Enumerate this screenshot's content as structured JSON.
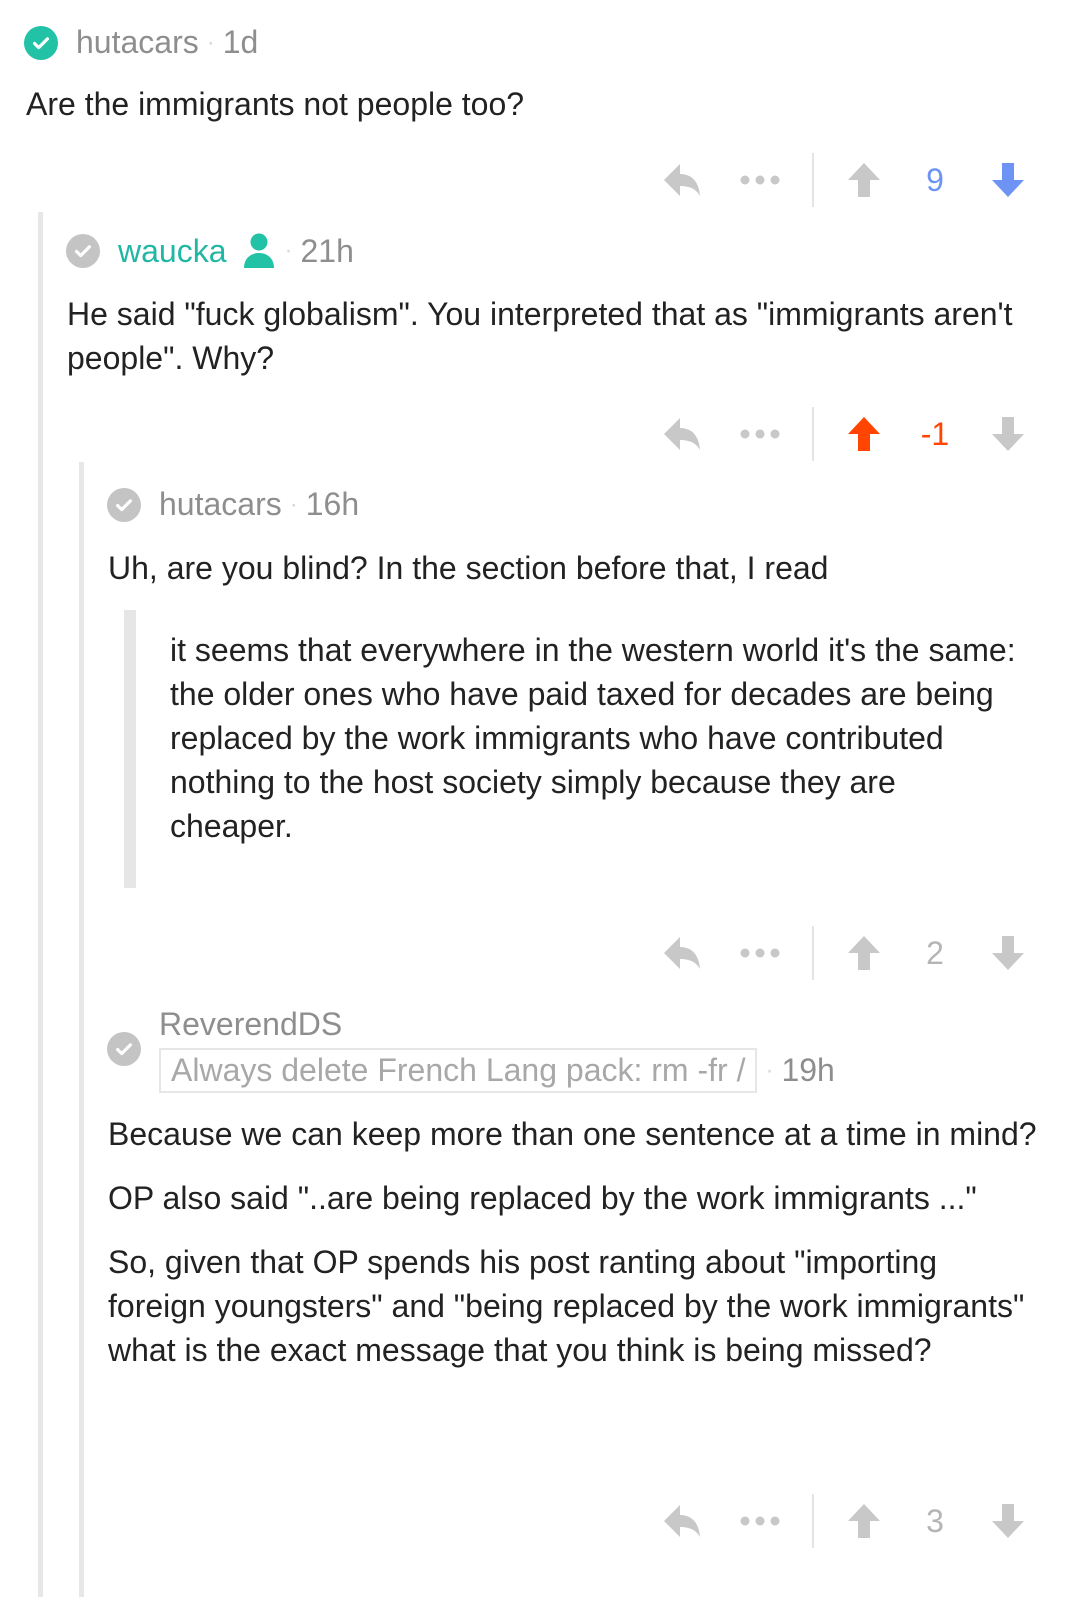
{
  "colors": {
    "teal": "#21b7a4",
    "upvote_orange": "#ff4500",
    "downvote_blue": "#6d94f5",
    "grey_icon": "#c8c8c8",
    "score_blue": "#6d94f5",
    "score_orange": "#ff4500",
    "score_grey": "#b5b5b5"
  },
  "comments": [
    {
      "author": "hutacars",
      "time": "1d",
      "badge_icon": "check-circle-green-icon",
      "body": [
        "Are the immigrants not people too?"
      ],
      "score": "9",
      "vote_state": "downvoted"
    },
    {
      "author": "waucka",
      "time": "21h",
      "badge_icon": "check-circle-grey-icon",
      "user_icon": "person-icon",
      "body": [
        "He said \"fuck globalism\". You interpreted that as \"immigrants aren't people\". Why?"
      ],
      "score": "-1",
      "vote_state": "upvoted"
    },
    {
      "author": "hutacars",
      "time": "16h",
      "badge_icon": "check-circle-grey-icon",
      "body": [
        "Uh, are you blind? In the section before that, I read"
      ],
      "quote": "it seems that everywhere in the western world it's the same: the older ones who have paid taxed for decades are being replaced by the work immigrants who have contributed nothing to the host society simply because they are cheaper.",
      "score": "2",
      "vote_state": "none"
    },
    {
      "author": "ReverendDS",
      "flair": "Always delete French Lang pack: rm -fr /",
      "time": "19h",
      "badge_icon": "check-circle-grey-icon",
      "body": [
        "Because we can keep more than one sentence at a time in mind?",
        "OP also said \"..are being replaced by the work immigrants ...\"",
        "So, given that OP spends his post ranting about \"importing foreign youngsters\" and \"being replaced by the work immigrants\" what is the exact message that you think is being missed?"
      ],
      "score": "3",
      "vote_state": "none"
    }
  ],
  "separator": "·"
}
